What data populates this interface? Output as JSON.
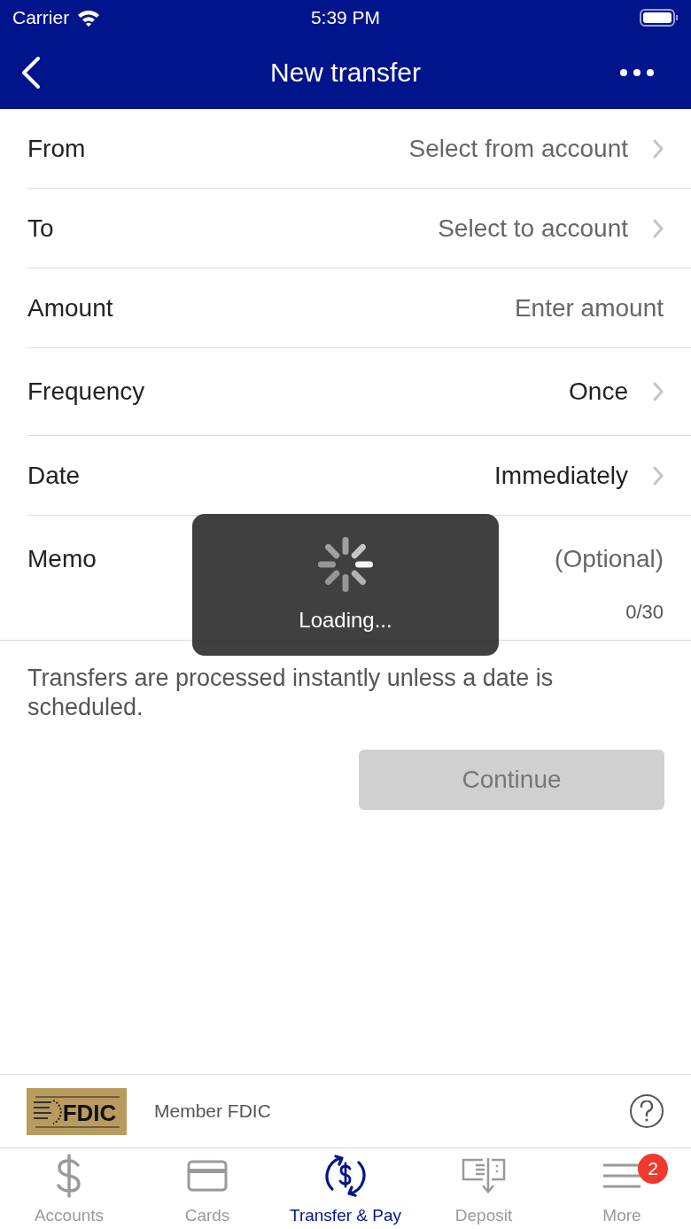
{
  "status_bar": {
    "carrier": "Carrier",
    "time": "5:39 PM"
  },
  "nav": {
    "title": "New transfer"
  },
  "form": [
    {
      "kind": "select",
      "label": "From",
      "placeholder": "Select from account"
    },
    {
      "kind": "select",
      "label": "To",
      "placeholder": "Select to account"
    },
    {
      "kind": "input",
      "label": "Amount",
      "placeholder": "Enter amount"
    },
    {
      "kind": "select",
      "label": "Frequency",
      "value": "Once"
    },
    {
      "kind": "select",
      "label": "Date",
      "value": "Immediately"
    },
    {
      "kind": "memo",
      "label": "Memo",
      "placeholder": "(Optional)",
      "counter": "0/30"
    }
  ],
  "note": "Transfers are processed instantly unless a date is scheduled.",
  "continue_button": {
    "label": "Continue",
    "disabled": true
  },
  "loading": {
    "text": "Loading..."
  },
  "footer": {
    "logo_text": "FDIC",
    "text": "Member FDIC"
  },
  "tabs": [
    {
      "label": "Accounts",
      "selected": false
    },
    {
      "label": "Cards",
      "selected": false
    },
    {
      "label": "Transfer & Pay",
      "selected": true
    },
    {
      "label": "Deposit",
      "selected": false
    },
    {
      "label": "More",
      "selected": false,
      "badge": "2"
    }
  ]
}
